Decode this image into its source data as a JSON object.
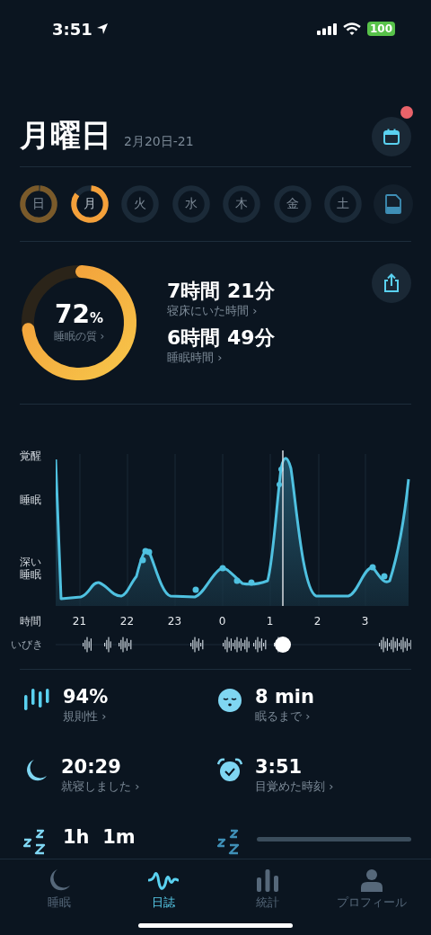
{
  "status_bar": {
    "time": "3:51",
    "battery": "100"
  },
  "header": {
    "title": "月曜日",
    "date_range": "2月20日-21",
    "calendar_badge": true
  },
  "days": [
    {
      "label": "日",
      "selected": false,
      "level": 1
    },
    {
      "label": "月",
      "selected": true,
      "level": 0.85
    },
    {
      "label": "火",
      "selected": false
    },
    {
      "label": "水",
      "selected": false
    },
    {
      "label": "木",
      "selected": false
    },
    {
      "label": "金",
      "selected": false
    },
    {
      "label": "土",
      "selected": false
    }
  ],
  "summary": {
    "quality": {
      "value": "72",
      "unit": "%",
      "label": "睡眠の質 ›",
      "level": 0.72
    },
    "stats": [
      {
        "value": "7時間 21分",
        "label": "寝床にいた時間 ›"
      },
      {
        "value": "6時間 49分",
        "label": "睡眠時間 ›"
      }
    ]
  },
  "sleep_graph": {
    "stage_labels": [
      "覚醒",
      "睡眠",
      "深い睡眠"
    ],
    "time_label": "時間",
    "hours": [
      "21",
      "22",
      "23",
      "0",
      "1",
      "2",
      "3"
    ],
    "snore_label": "いびき"
  },
  "metrics": [
    {
      "kind": "value",
      "value": "94%",
      "label": "規則性 ›"
    },
    {
      "kind": "value",
      "value": "8 min",
      "label": "眠るまで ›"
    },
    {
      "kind": "value",
      "value": "20:29",
      "label": "就寝しました ›"
    },
    {
      "kind": "value",
      "value": "3:51",
      "label": "目覚めた時刻 ›"
    },
    {
      "kind": "value",
      "value": "1h  1m"
    },
    {
      "kind": "loading"
    }
  ],
  "tabs": [
    {
      "label": "睡眠",
      "selected": false
    },
    {
      "label": "日誌",
      "selected": true
    },
    {
      "label": "統計",
      "selected": false
    },
    {
      "label": "プロフィール",
      "selected": false
    }
  ]
}
